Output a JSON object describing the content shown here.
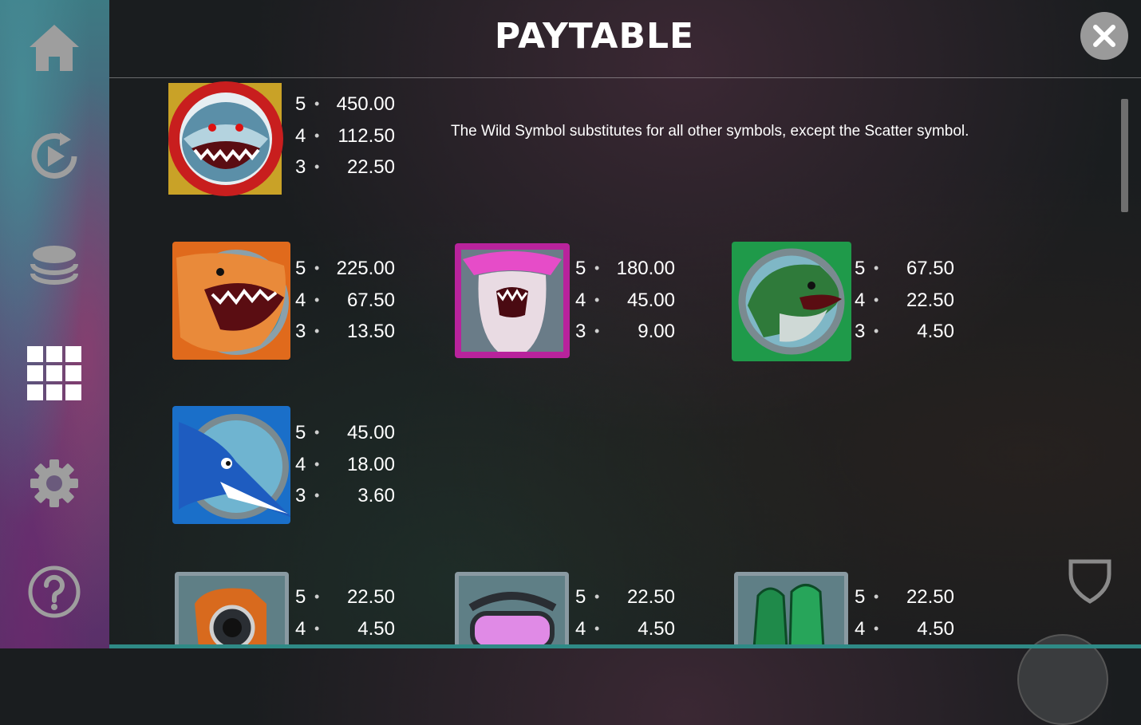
{
  "header": {
    "title": "PAYTABLE"
  },
  "sidebar": {
    "items": [
      {
        "icon": "home-icon"
      },
      {
        "icon": "autoplay-icon"
      },
      {
        "icon": "coins-icon"
      },
      {
        "icon": "paytable-grid-icon",
        "active": true
      },
      {
        "icon": "gear-icon"
      },
      {
        "icon": "help-icon"
      }
    ]
  },
  "wild": {
    "description": "The Wild Symbol substitutes for all other symbols, except the Scatter symbol.",
    "pays": [
      {
        "count": "5",
        "value": "450.00"
      },
      {
        "count": "4",
        "value": "112.50"
      },
      {
        "count": "3",
        "value": "22.50"
      }
    ]
  },
  "symbols": [
    {
      "id": "orange-shark",
      "pays": [
        {
          "count": "5",
          "value": "225.00"
        },
        {
          "count": "4",
          "value": "67.50"
        },
        {
          "count": "3",
          "value": "13.50"
        }
      ]
    },
    {
      "id": "pink-hammerhead",
      "pays": [
        {
          "count": "5",
          "value": "180.00"
        },
        {
          "count": "4",
          "value": "45.00"
        },
        {
          "count": "3",
          "value": "9.00"
        }
      ]
    },
    {
      "id": "green-shark",
      "pays": [
        {
          "count": "5",
          "value": "67.50"
        },
        {
          "count": "4",
          "value": "22.50"
        },
        {
          "count": "3",
          "value": "4.50"
        }
      ]
    },
    {
      "id": "blue-swordfish",
      "pays": [
        {
          "count": "5",
          "value": "45.00"
        },
        {
          "count": "4",
          "value": "18.00"
        },
        {
          "count": "3",
          "value": "3.60"
        }
      ]
    },
    {
      "id": "diving-camera",
      "pays": [
        {
          "count": "5",
          "value": "22.50"
        },
        {
          "count": "4",
          "value": "4.50"
        }
      ]
    },
    {
      "id": "diving-mask",
      "pays": [
        {
          "count": "5",
          "value": "22.50"
        },
        {
          "count": "4",
          "value": "4.50"
        }
      ]
    },
    {
      "id": "diving-fins",
      "pays": [
        {
          "count": "5",
          "value": "22.50"
        },
        {
          "count": "4",
          "value": "4.50"
        }
      ]
    }
  ],
  "dot": "•",
  "colors": {
    "orange": "#e06a1c",
    "pink": "#b8239c",
    "green": "#1f9a4a",
    "blue": "#1a6fc9",
    "gray_frame": "#8a9aa2"
  }
}
